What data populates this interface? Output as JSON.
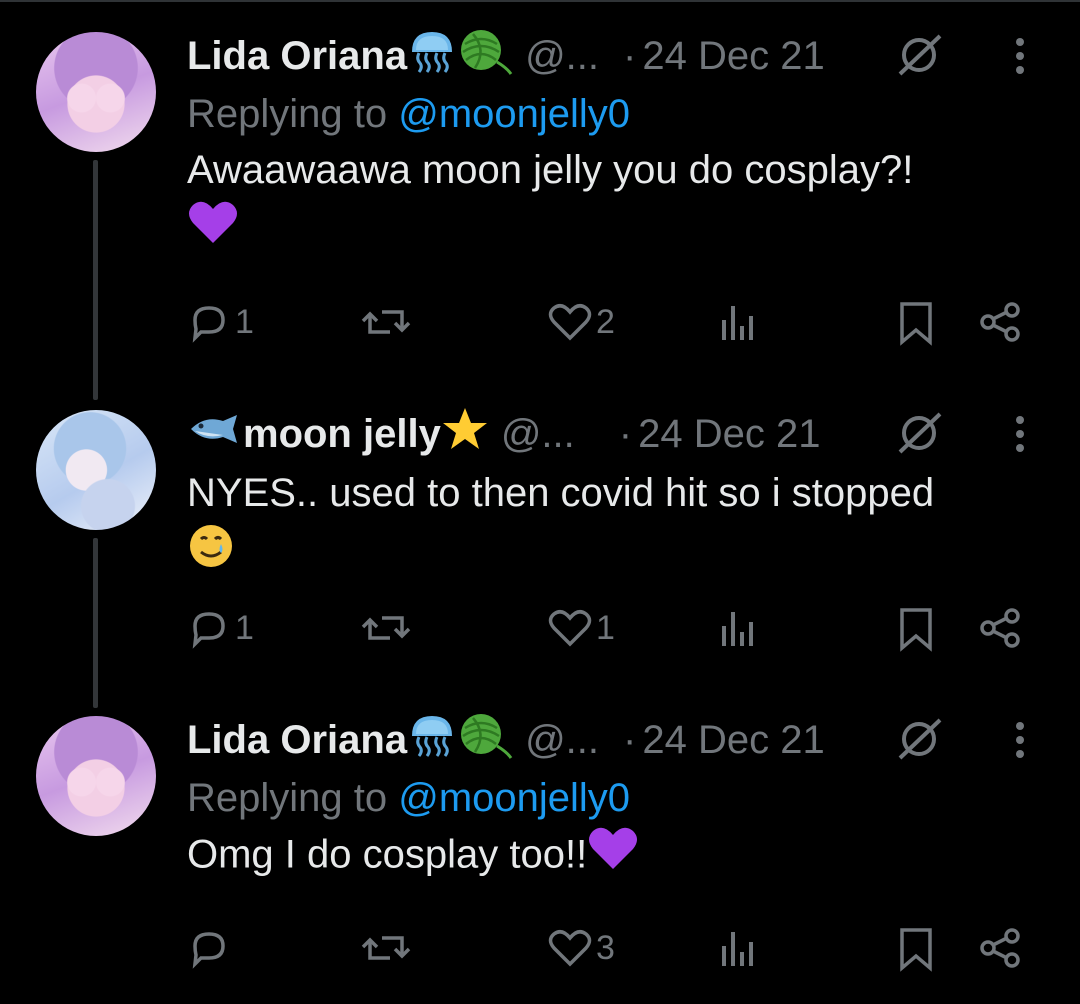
{
  "tweets": [
    {
      "name": "Lida Oriana",
      "handle": "@...",
      "dot": "·",
      "date": "24 Dec 21",
      "replying_prefix": "Replying to ",
      "replying_to": "@moonjelly0",
      "text": "Awaawaawa moon jelly you do cosplay?!",
      "text_emoji": "purple-heart",
      "name_emojis": [
        "jellyfish",
        "yarn"
      ],
      "actions": {
        "replies": "1",
        "retweets": "",
        "likes": "2"
      }
    },
    {
      "name": "moon jelly",
      "handle": "@...",
      "dot": "·",
      "date": "24 Dec 21",
      "text": "NYES.. used to then covid hit so i stopped",
      "text_emoji": "smiling-face-with-tear",
      "name_emojis": [
        "fish",
        "star"
      ],
      "actions": {
        "replies": "1",
        "retweets": "",
        "likes": "1"
      }
    },
    {
      "name": "Lida Oriana",
      "handle": "@...",
      "dot": "·",
      "date": "24 Dec 21",
      "replying_prefix": "Replying to ",
      "replying_to": "@moonjelly0",
      "text": "Omg I do cosplay too!!",
      "text_emoji": "purple-heart",
      "name_emojis": [
        "jellyfish",
        "yarn"
      ],
      "actions": {
        "replies": "",
        "retweets": "",
        "likes": "3"
      }
    }
  ],
  "colors": {
    "background": "#000000",
    "text": "#e7e9ea",
    "muted": "#71767b",
    "link": "#1d9bf0",
    "thread_line": "#333639"
  }
}
